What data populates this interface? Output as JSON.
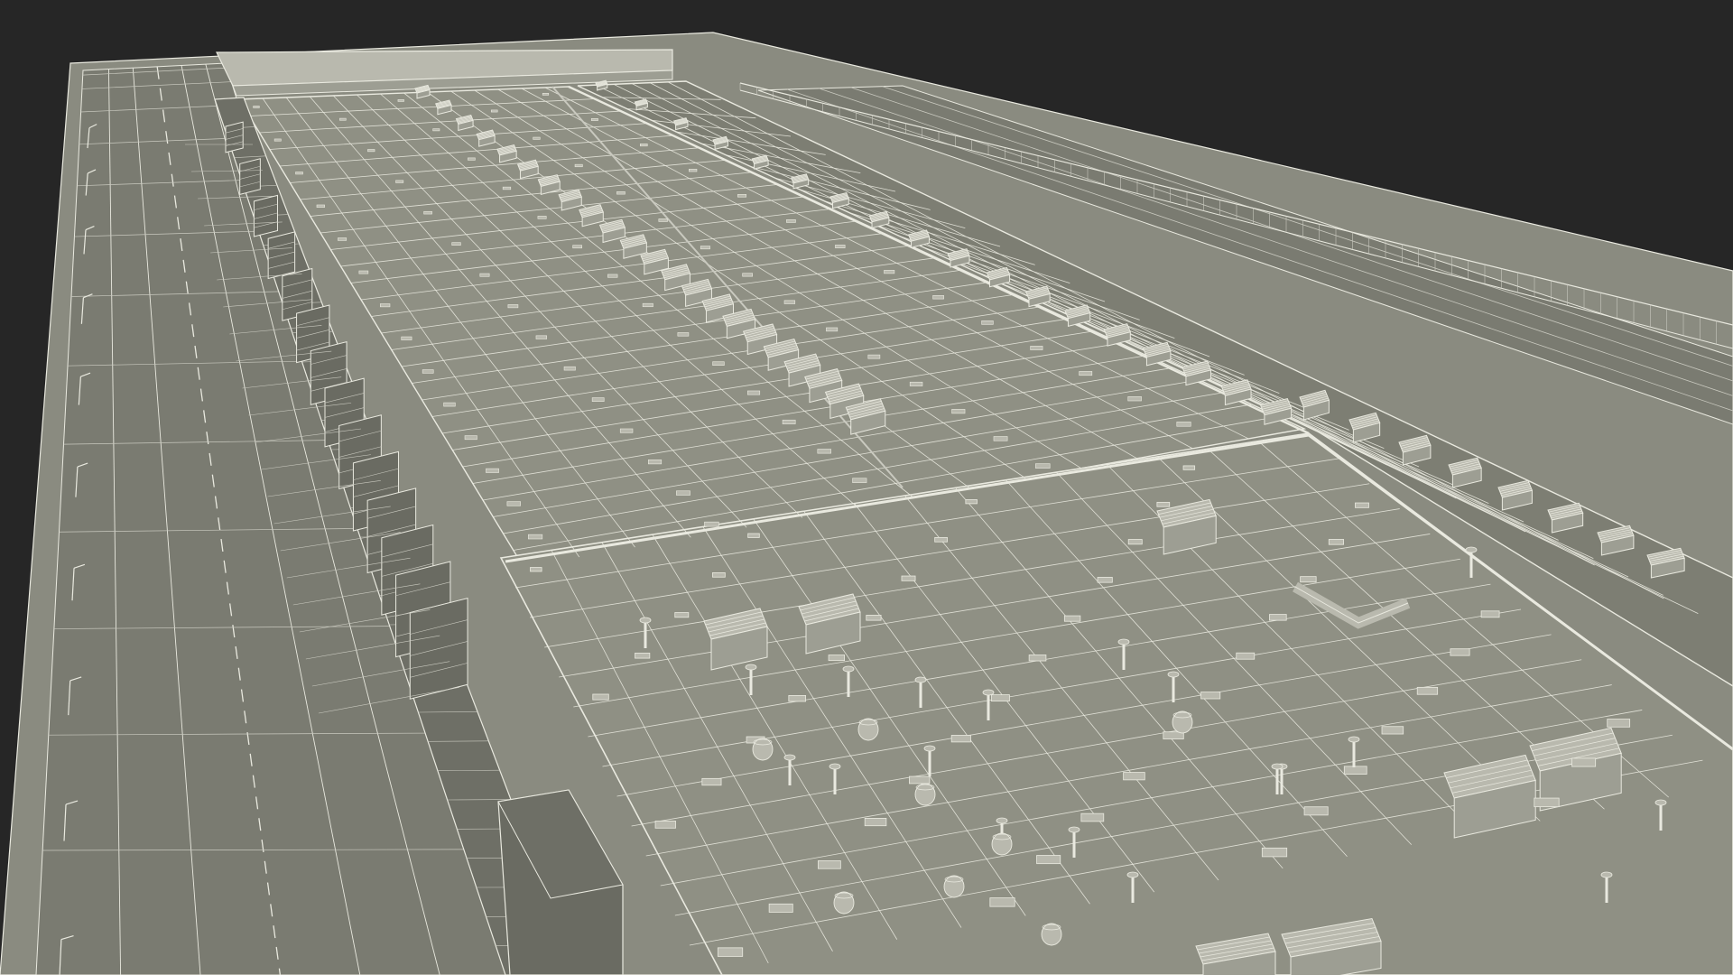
{
  "scene": {
    "subject": "wireframe-3d-render",
    "colors": {
      "background": "#262626",
      "roof": "#8f9084",
      "roof_dark": "#7d7e73",
      "ground": "#8a8b80",
      "road": "#7a7b71",
      "wall": "#6e6f66",
      "wire": "#e9e9df",
      "wire_dim": "#c9c9bf",
      "unit_top": "#b9b9ae",
      "unit_side": "#9d9e93",
      "unit_dark": "#6a6b62"
    }
  }
}
